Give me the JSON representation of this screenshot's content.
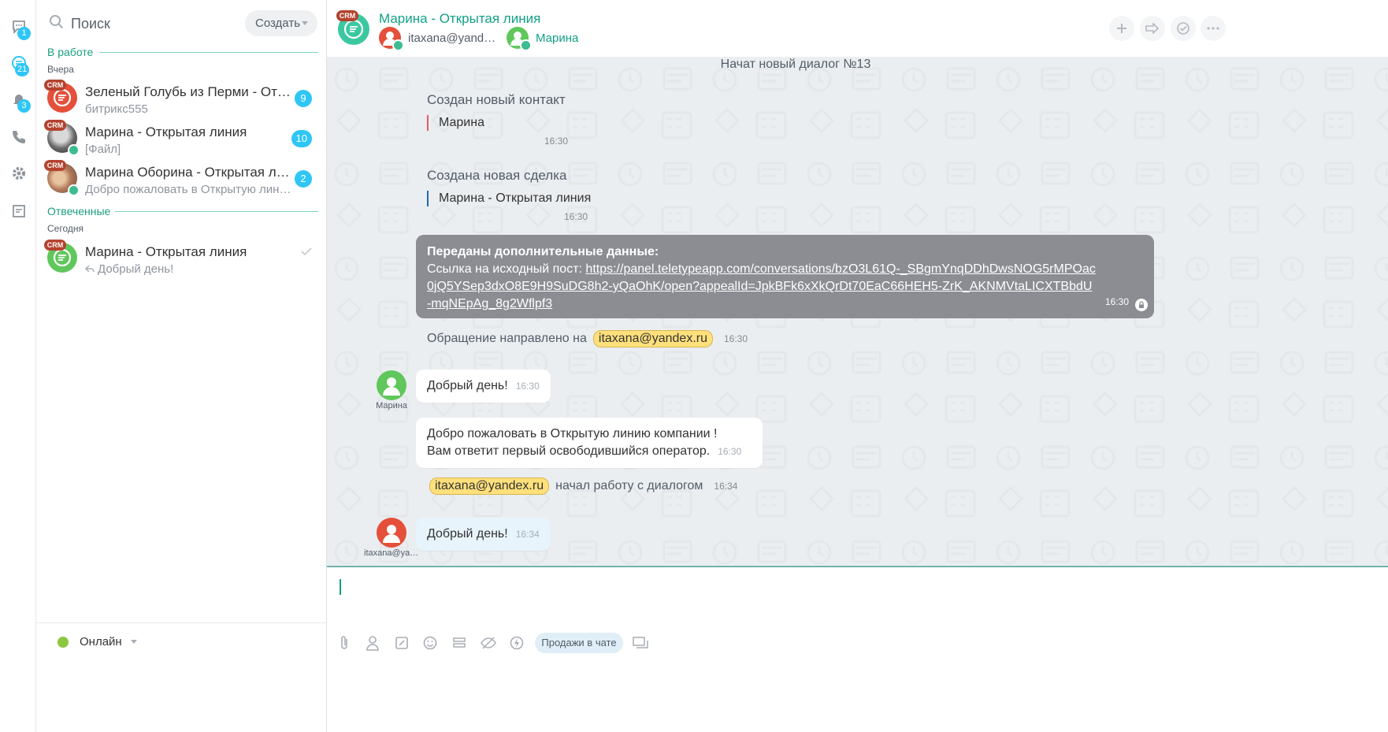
{
  "rail": {
    "items": [
      {
        "name": "chats",
        "badge": "1"
      },
      {
        "name": "open-lines",
        "badge": "21"
      },
      {
        "name": "notifications",
        "badge": "3"
      },
      {
        "name": "phone",
        "badge": ""
      },
      {
        "name": "settings",
        "badge": ""
      },
      {
        "name": "feed",
        "badge": ""
      }
    ]
  },
  "recent": {
    "search_placeholder": "Поиск",
    "create_label": "Создать",
    "sections": [
      {
        "title": "В работе",
        "date": "Вчера",
        "items": [
          {
            "title": "Зеленый Голубь из Перми - Открытая линия",
            "subtitle": "битрикс555",
            "counter": "9",
            "crm": "CRM"
          },
          {
            "title": "Марина - Открытая линия",
            "subtitle": "[Файл]",
            "counter": "10",
            "crm": "CRM"
          },
          {
            "title": "Марина Оборина - Открытая линия",
            "subtitle": "Добро пожаловать в Открытую линию компании !",
            "counter": "2",
            "crm": "CRM"
          }
        ]
      },
      {
        "title": "Отвеченные",
        "date": "Сегодня",
        "items": [
          {
            "title": "Марина - Открытая линия",
            "subtitle": "Добрый день!",
            "counter": "",
            "crm": "CRM"
          }
        ]
      }
    ],
    "status_label": "Онлайн"
  },
  "header": {
    "crm": "CRM",
    "title": "Марина - Открытая линия",
    "operator_name": "itaxana@yandex.ru",
    "client_name": "Марина"
  },
  "messages": {
    "dialog_start": "Начат новый диалог №13",
    "contact_created": {
      "title": "Создан новый контакт",
      "body": "Марина",
      "time": "16:30"
    },
    "deal_created": {
      "title": "Создана новая сделка",
      "body": "Марина - Открытая линия",
      "time": "16:30"
    },
    "extra_data": {
      "title": "Переданы дополнительные данные:",
      "link_label": "Ссылка на исходный пост:",
      "link_url": "https://panel.teletypeapp.com/conversations/bzO3L61Q-_SBgmYnqDDhDwsNOG5rMPOac0jQ5YSep3dxO8E9H9SuDG8h2-yQaOhK/open?appealId=JpkBFk6xXkQrDt70EaC66HEH5-ZrK_AKNMVtaLICXTBbdU-mqNEpAg_8g2Wflpf3",
      "time": "16:30"
    },
    "forwarded": {
      "text": "Обращение направлено на",
      "mention": "itaxana@yandex.ru",
      "time": "16:30"
    },
    "client_msg": {
      "author": "Марина",
      "text": "Добрый день!",
      "time": "16:30"
    },
    "welcome_msg": {
      "line1": "Добро пожаловать в Открытую линию компании !",
      "line2": "Вам ответит первый освободившийся оператор.",
      "time": "16:30"
    },
    "started": {
      "mention": "itaxana@yandex.ru",
      "text": "начал работу с диалогом",
      "time": "16:34"
    },
    "operator_msg": {
      "author": "itaxana@yandex.ru",
      "text": "Добрый день!",
      "time": "16:34"
    }
  },
  "composer": {
    "sales_label": "Продажи в чате"
  },
  "colors": {
    "accent": "#11a087",
    "badge": "#2fc6f6",
    "crm": "#b4422e",
    "online": "#8dc63f",
    "operator_avatar": "#e4503a",
    "client_avatar": "#5fc75b"
  }
}
